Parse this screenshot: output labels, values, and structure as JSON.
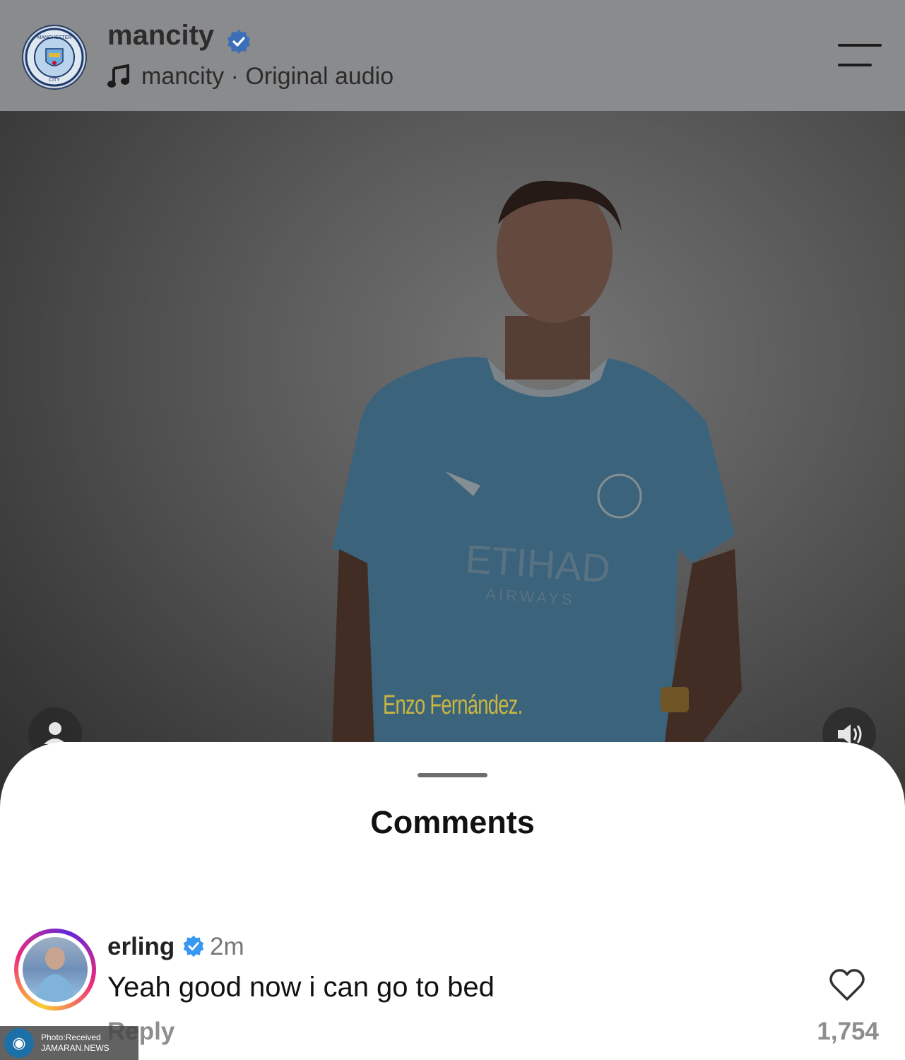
{
  "header": {
    "username": "mancity",
    "audio_label": "mancity · Original audio",
    "avatar_crest_text_top": "MANCHESTER",
    "avatar_crest_text_bottom": "CITY",
    "icons": {
      "verified": "verified-badge-icon",
      "music": "music-note-icon",
      "menu": "menu-icon"
    }
  },
  "video": {
    "caption": "Enzo Fernández.",
    "shirt_sponsor": "ETIHAD",
    "shirt_sponsor_sub": "AIRWAYS",
    "icons": {
      "tagged": "person-icon",
      "sound": "speaker-icon"
    }
  },
  "comments_sheet": {
    "title": "Comments",
    "comments": [
      {
        "username": "erling",
        "time": "2m",
        "text": "Yeah good now i can go to bed",
        "reply_label": "Reply",
        "like_count": "1,754"
      }
    ]
  },
  "watermark": {
    "line1": "Photo:Received",
    "line2": "JAMARAN.NEWS"
  },
  "colors": {
    "verified_blue": "#3897f0",
    "header_bg": "#8a8b8d",
    "caption_yellow": "#c9b640"
  }
}
